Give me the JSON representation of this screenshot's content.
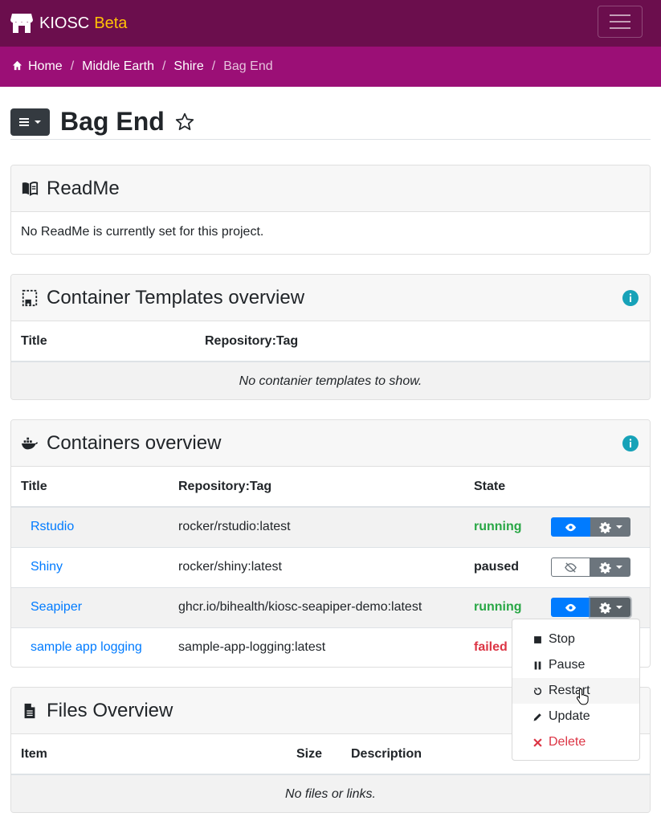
{
  "navbar": {
    "brand": "KIOSC",
    "badge": "Beta"
  },
  "breadcrumb": {
    "items": [
      "Home",
      "Middle Earth",
      "Shire"
    ],
    "active": "Bag End"
  },
  "page": {
    "title": "Bag End"
  },
  "readme": {
    "title": "ReadMe",
    "body": "No ReadMe is currently set for this project."
  },
  "templates": {
    "title": "Container Templates overview",
    "columns": [
      "Title",
      "Repository:Tag"
    ],
    "empty": "No contanier templates to show."
  },
  "containers": {
    "title": "Containers overview",
    "columns": [
      "Title",
      "Repository:Tag",
      "State"
    ],
    "rows": [
      {
        "title": "Rstudio",
        "repo": "rocker/rstudio:latest",
        "state": "running"
      },
      {
        "title": "Shiny",
        "repo": "rocker/shiny:latest",
        "state": "paused"
      },
      {
        "title": "Seapiper",
        "repo": "ghcr.io/bihealth/kiosc-seapiper-demo:latest",
        "state": "running"
      },
      {
        "title": "sample app logging",
        "repo": "sample-app-logging:latest",
        "state": "failed"
      }
    ]
  },
  "dropdown": {
    "items": [
      "Stop",
      "Pause",
      "Restart",
      "Update",
      "Delete"
    ]
  },
  "files": {
    "title": "Files Overview",
    "columns": [
      "Item",
      "Size",
      "Description"
    ],
    "empty": "No files or links."
  },
  "colors": {
    "navbar": "#6b0e4d",
    "breadcrumb": "#9b0f76",
    "running": "#28a745",
    "failed": "#dc3545",
    "link": "#007bff",
    "info": "#17a2b8"
  },
  "icons": [
    "store-icon",
    "home-icon",
    "star-outline-icon",
    "book-icon",
    "template-icon",
    "docker-icon",
    "file-icon",
    "info-icon",
    "eye-icon",
    "eye-off-icon",
    "gear-icon",
    "stop-icon",
    "pause-icon",
    "restart-icon",
    "pencil-icon",
    "close-icon"
  ]
}
